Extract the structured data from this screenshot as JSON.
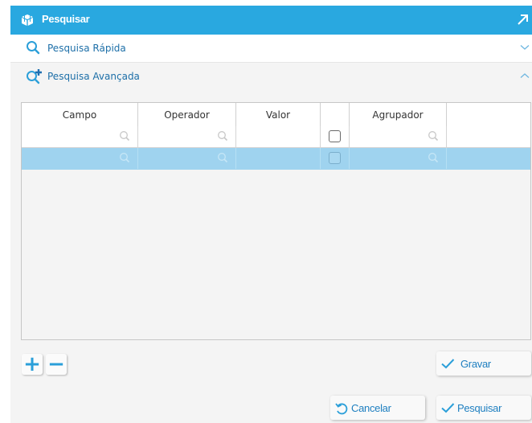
{
  "header": {
    "title": "Pesquisar"
  },
  "sections": {
    "quick": {
      "label": "Pesquisa Rápida"
    },
    "advanced": {
      "label": "Pesquisa Avançada"
    }
  },
  "grid": {
    "columns": [
      "Campo",
      "Operador",
      "Valor",
      "",
      "Agrupador",
      ""
    ],
    "rows": [
      {
        "selected": false,
        "checked": false
      },
      {
        "selected": true,
        "checked": false
      }
    ]
  },
  "buttons": {
    "add": "+",
    "remove": "−",
    "save": "Gravar",
    "cancel": "Cancelar",
    "search": "Pesquisar"
  },
  "icons": {
    "header": "cube-icon",
    "expand": "expand-arrow-icon",
    "quick": "search-icon",
    "advanced": "search-plus-icon",
    "check": "check-icon",
    "undo": "undo-icon"
  },
  "colors": {
    "header_bg": "#29a8e0",
    "accent": "#1e7fc0",
    "selected_row": "#9fd3ef"
  }
}
